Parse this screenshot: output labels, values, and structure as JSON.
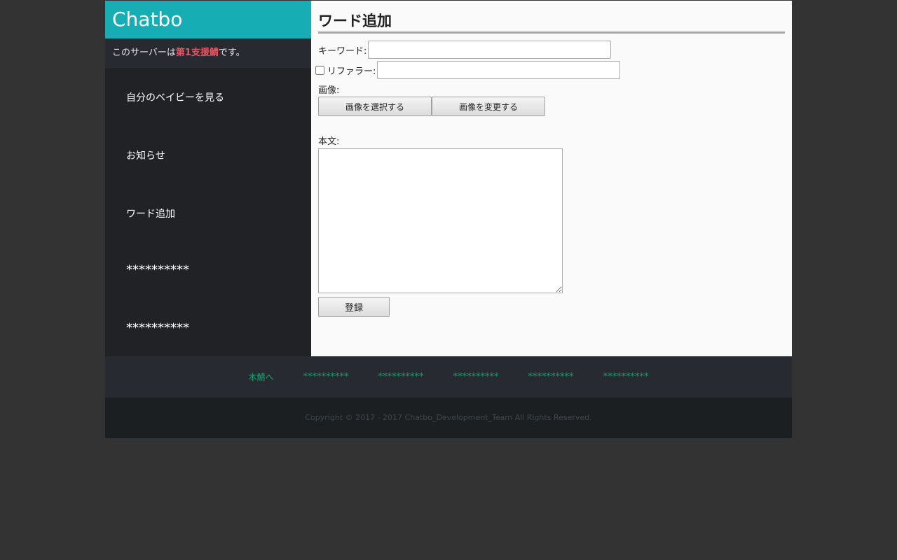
{
  "sidebar": {
    "brand": "Chatbo",
    "status_prefix": "このサーバーは",
    "status_highlight": "第1支援鯖",
    "status_suffix": "です。",
    "items": [
      {
        "label": "自分のベイビーを見る"
      },
      {
        "label": "お知らせ"
      },
      {
        "label": "ワード追加"
      },
      {
        "label": "**********"
      },
      {
        "label": "**********"
      }
    ]
  },
  "main": {
    "title": "ワード追加",
    "keyword_label": "キーワード:",
    "keyword_value": "",
    "referrer_label": "リファラー:",
    "referrer_checked": false,
    "referrer_value": "",
    "image_label": "画像:",
    "select_image_button": "画像を選択する",
    "change_image_button": "画像を変更する",
    "body_label": "本文:",
    "body_value": "",
    "submit_button": "登録"
  },
  "footer": {
    "links": [
      {
        "label": "本鯖へ"
      },
      {
        "label": "**********"
      },
      {
        "label": "**********"
      },
      {
        "label": "**********"
      },
      {
        "label": "**********"
      },
      {
        "label": "**********"
      }
    ],
    "copyright": "Copyright © 2017 - 2017 Chatbo_Development_Team All Rights Reserved."
  },
  "colors": {
    "brand_bg": "#16adb5",
    "highlight": "#e8555e",
    "footer_link": "#1e9c6a"
  }
}
